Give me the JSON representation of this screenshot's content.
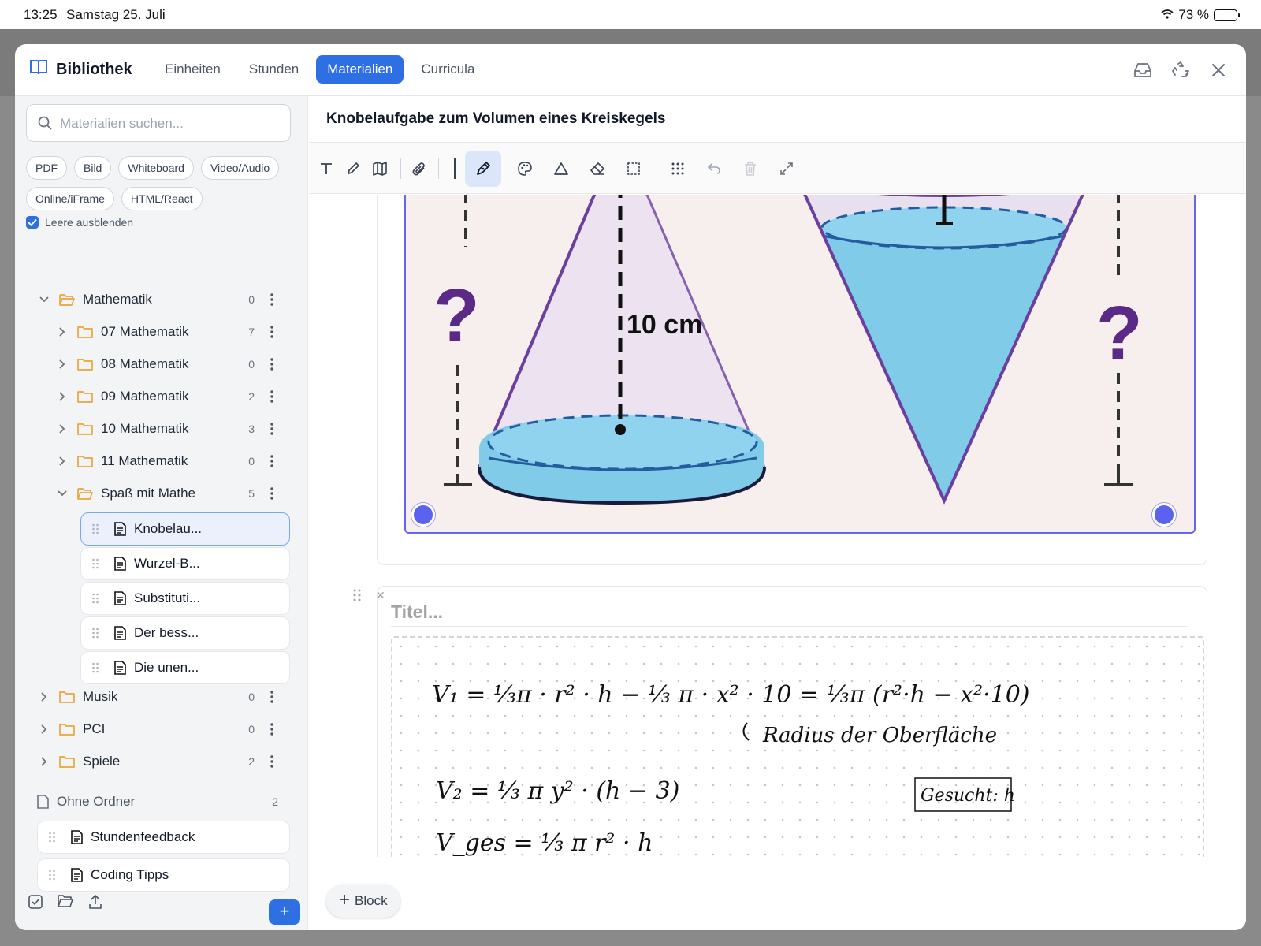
{
  "status": {
    "time": "13:25",
    "date": "Samstag 25. Juli",
    "battery": "73 %"
  },
  "app": {
    "title": "Bibliothek"
  },
  "nav": {
    "tabs": [
      {
        "label": "Einheiten"
      },
      {
        "label": "Stunden"
      },
      {
        "label": "Materialien",
        "active": true
      },
      {
        "label": "Curricula"
      }
    ]
  },
  "sidebar": {
    "search_placeholder": "Materialien suchen...",
    "filters": [
      "PDF",
      "Bild",
      "Whiteboard",
      "Video/Audio",
      "Online/iFrame",
      "HTML/React"
    ],
    "hide_empty": "Leere ausblenden",
    "root": {
      "label": "Mathematik",
      "count": "0"
    },
    "folders": [
      {
        "label": "07 Mathematik",
        "count": "7"
      },
      {
        "label": "08 Mathematik",
        "count": "0"
      },
      {
        "label": "09 Mathematik",
        "count": "2"
      },
      {
        "label": "10 Mathematik",
        "count": "3"
      },
      {
        "label": "11 Mathematik",
        "count": "0"
      },
      {
        "label": "Spaß mit Mathe",
        "count": "5"
      }
    ],
    "materials": [
      "Knobelau...",
      "Wurzel-B...",
      "Substituti...",
      "Der bess...",
      "Die unen..."
    ],
    "top_folders": [
      {
        "label": "Musik",
        "count": "0"
      },
      {
        "label": "PCI",
        "count": "0"
      },
      {
        "label": "Spiele",
        "count": "2"
      }
    ],
    "no_folder": {
      "label": "Ohne Ordner",
      "count": "2"
    },
    "loose_materials": [
      "Stundenfeedback",
      "Coding Tipps"
    ],
    "add_label": "+"
  },
  "main": {
    "title": "Knobelaufgabe zum Volumen eines Kreiskegels",
    "image_label": "10 cm",
    "title_placeholder": "Titel...",
    "add_block": "Block",
    "handwriting": {
      "line1": "V₁ = ⅓π · r² · h − ⅓ π · x² · 10 = ⅓π (r²·h − x²·10)",
      "note": "Radius der Oberfläche",
      "line2": "V₂ = ⅓ π y² · (h − 3)",
      "boxed": "Gesucht: h",
      "line3": "V_ges = ⅓ π r² · h"
    }
  },
  "colors": {
    "accent": "#2f6fe4",
    "folder": "#e9a53b",
    "handle": "#5b63ee",
    "water": "#7fcbe8",
    "cone": "#6b3f9e"
  }
}
